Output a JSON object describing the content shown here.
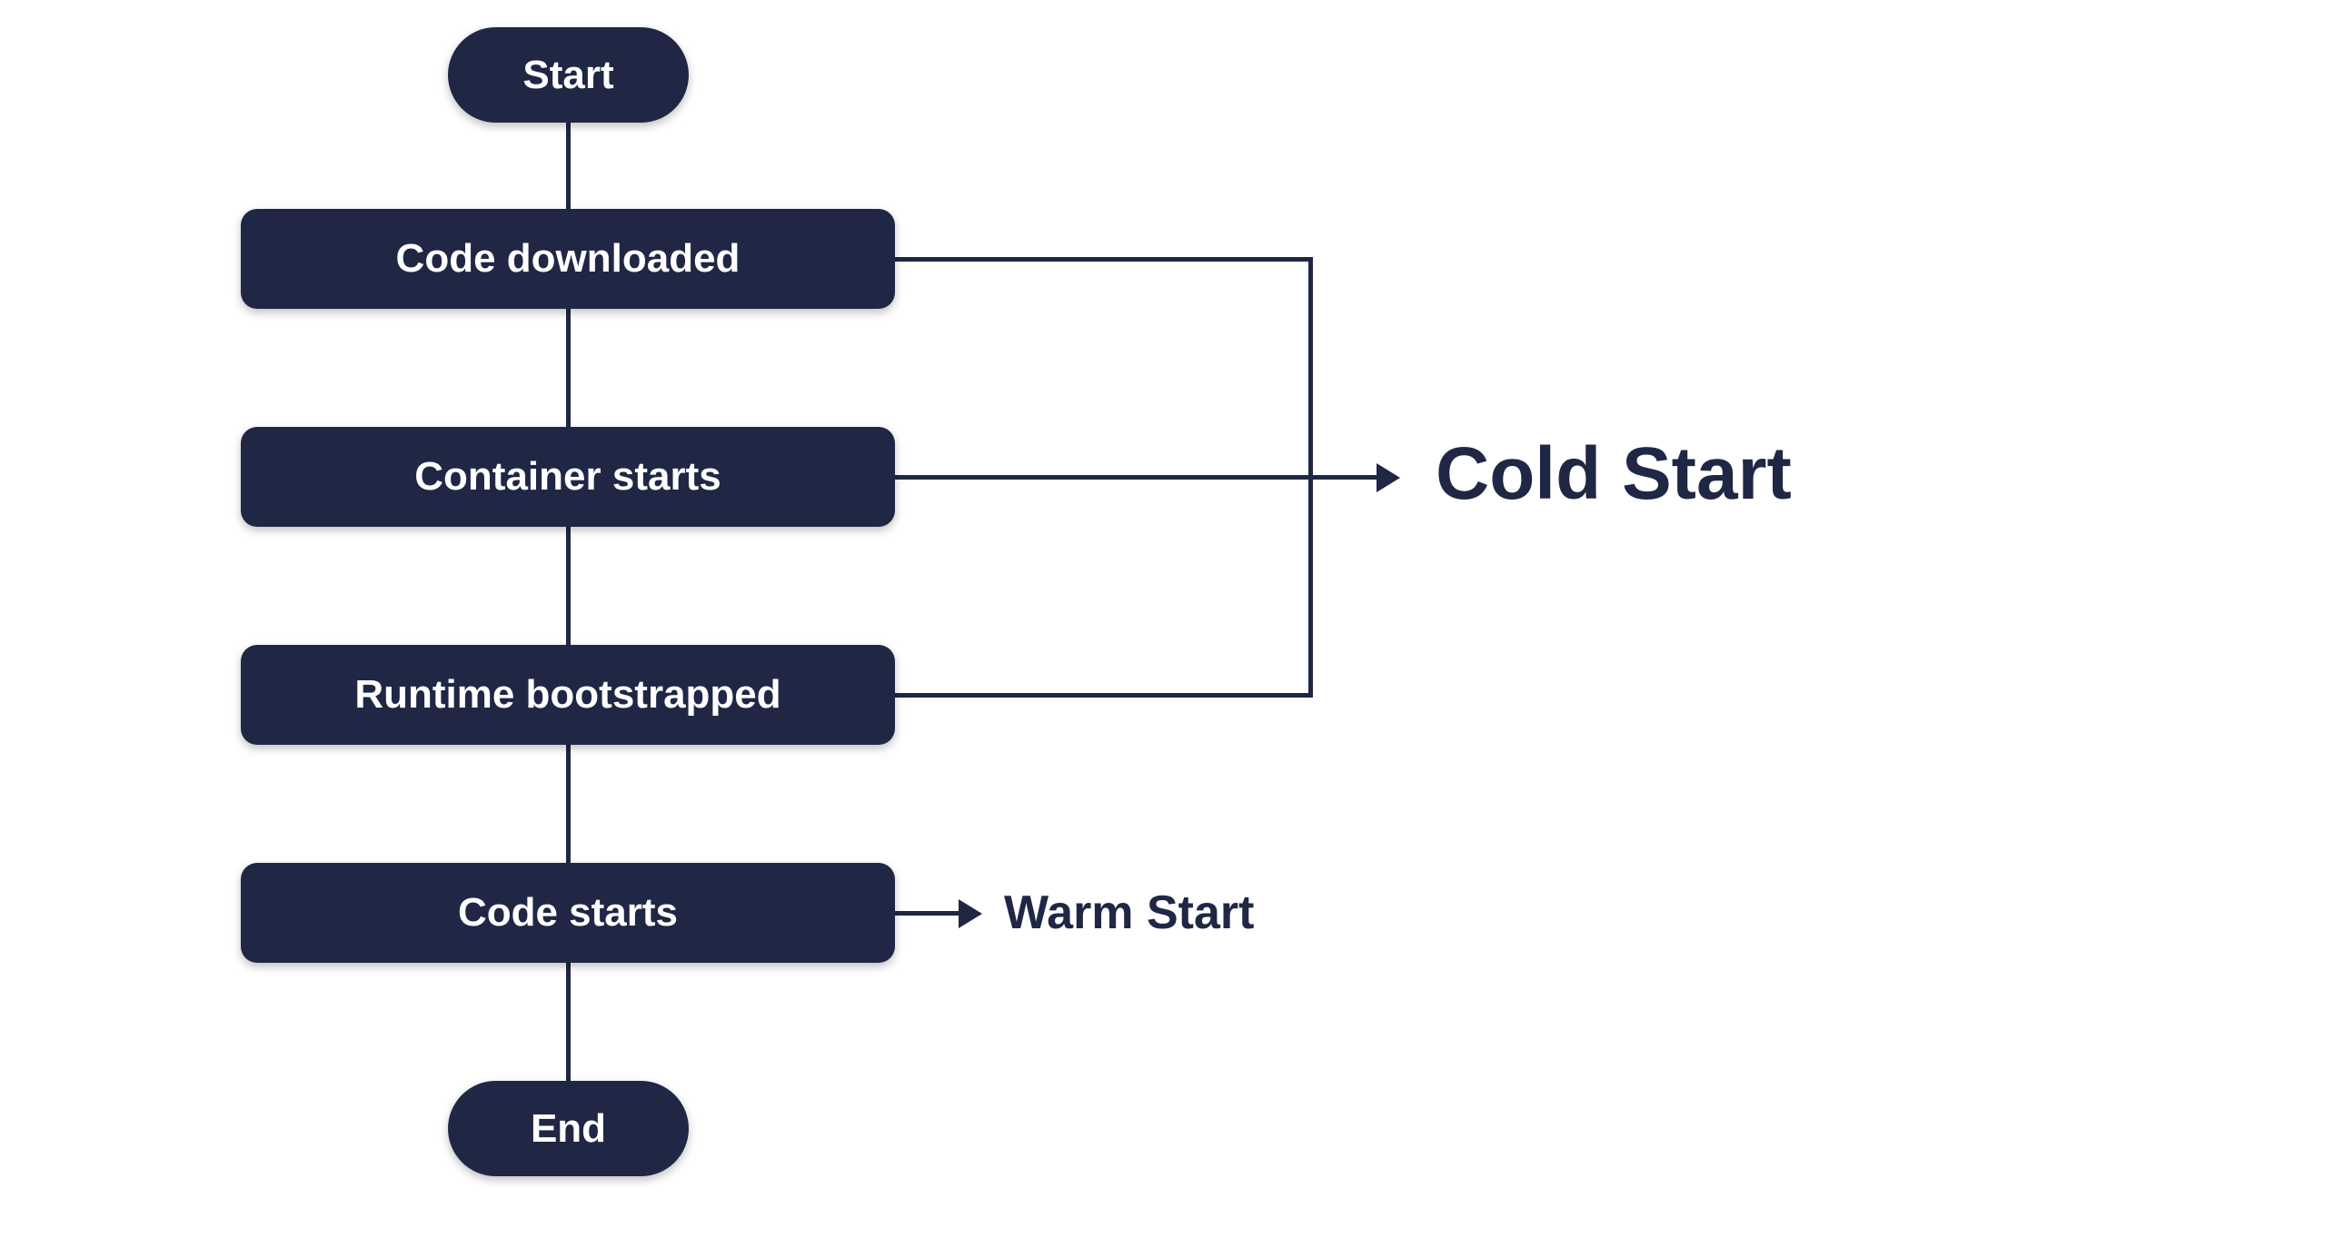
{
  "nodes": {
    "start": "Start",
    "step1": "Code downloaded",
    "step2": "Container starts",
    "step3": "Runtime bootstrapped",
    "step4": "Code starts",
    "end": "End"
  },
  "labels": {
    "cold": "Cold Start",
    "warm": "Warm Start"
  },
  "colors": {
    "node_fill": "#1f2745",
    "node_text": "#ffffff",
    "label_text": "#1f2745",
    "line": "#1f2745"
  },
  "chart_data": {
    "type": "flowchart",
    "title": "",
    "nodes": [
      {
        "id": "start",
        "kind": "terminator",
        "label": "Start"
      },
      {
        "id": "step1",
        "kind": "process",
        "label": "Code downloaded"
      },
      {
        "id": "step2",
        "kind": "process",
        "label": "Container starts"
      },
      {
        "id": "step3",
        "kind": "process",
        "label": "Runtime bootstrapped"
      },
      {
        "id": "step4",
        "kind": "process",
        "label": "Code starts"
      },
      {
        "id": "end",
        "kind": "terminator",
        "label": "End"
      }
    ],
    "edges": [
      {
        "from": "start",
        "to": "step1"
      },
      {
        "from": "step1",
        "to": "step2"
      },
      {
        "from": "step2",
        "to": "step3"
      },
      {
        "from": "step3",
        "to": "step4"
      },
      {
        "from": "step4",
        "to": "end"
      }
    ],
    "groups": [
      {
        "label": "Cold Start",
        "members": [
          "step1",
          "step2",
          "step3"
        ]
      },
      {
        "label": "Warm Start",
        "members": [
          "step4"
        ]
      }
    ]
  }
}
